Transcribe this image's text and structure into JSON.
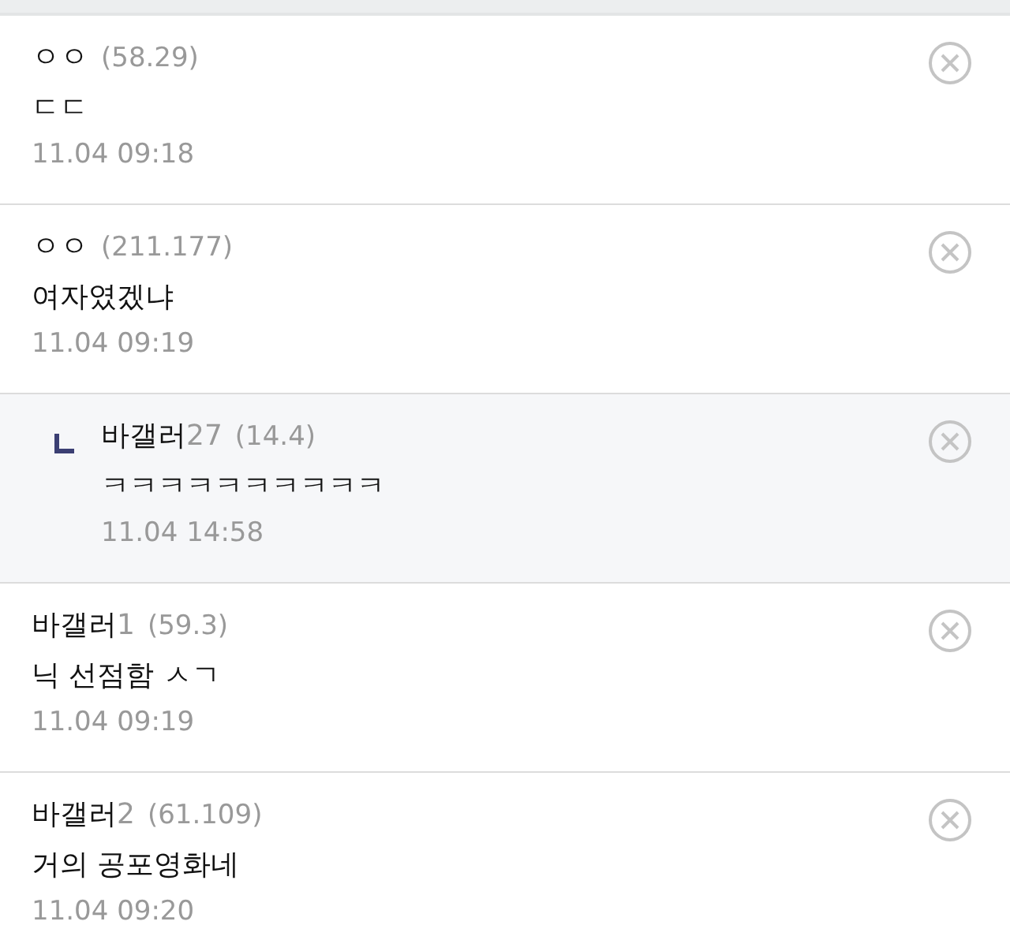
{
  "comments": [
    {
      "kind": "comment",
      "author": "ㅇㅇ",
      "ip": "(58.29)",
      "text": "ㄷㄷ",
      "date": "11.04 09:18"
    },
    {
      "kind": "comment",
      "author": "ㅇㅇ",
      "ip": "(211.177)",
      "text": "여자였겠냐",
      "date": "11.04 09:19"
    },
    {
      "kind": "reply",
      "author": "바갤러",
      "author_number": "27",
      "ip": "(14.4)",
      "text": "ㅋㅋㅋㅋㅋㅋㅋㅋㅋㅋ",
      "date": "11.04 14:58"
    },
    {
      "kind": "comment",
      "author": "바갤러",
      "author_number": "1",
      "ip": "(59.3)",
      "text": "닉 선점함 ㅅㄱ",
      "date": "11.04 09:19"
    },
    {
      "kind": "comment",
      "author": "바갤러",
      "author_number": "2",
      "ip": "(61.109)",
      "text": "거의 공포영화네",
      "date": "11.04 09:20"
    }
  ]
}
